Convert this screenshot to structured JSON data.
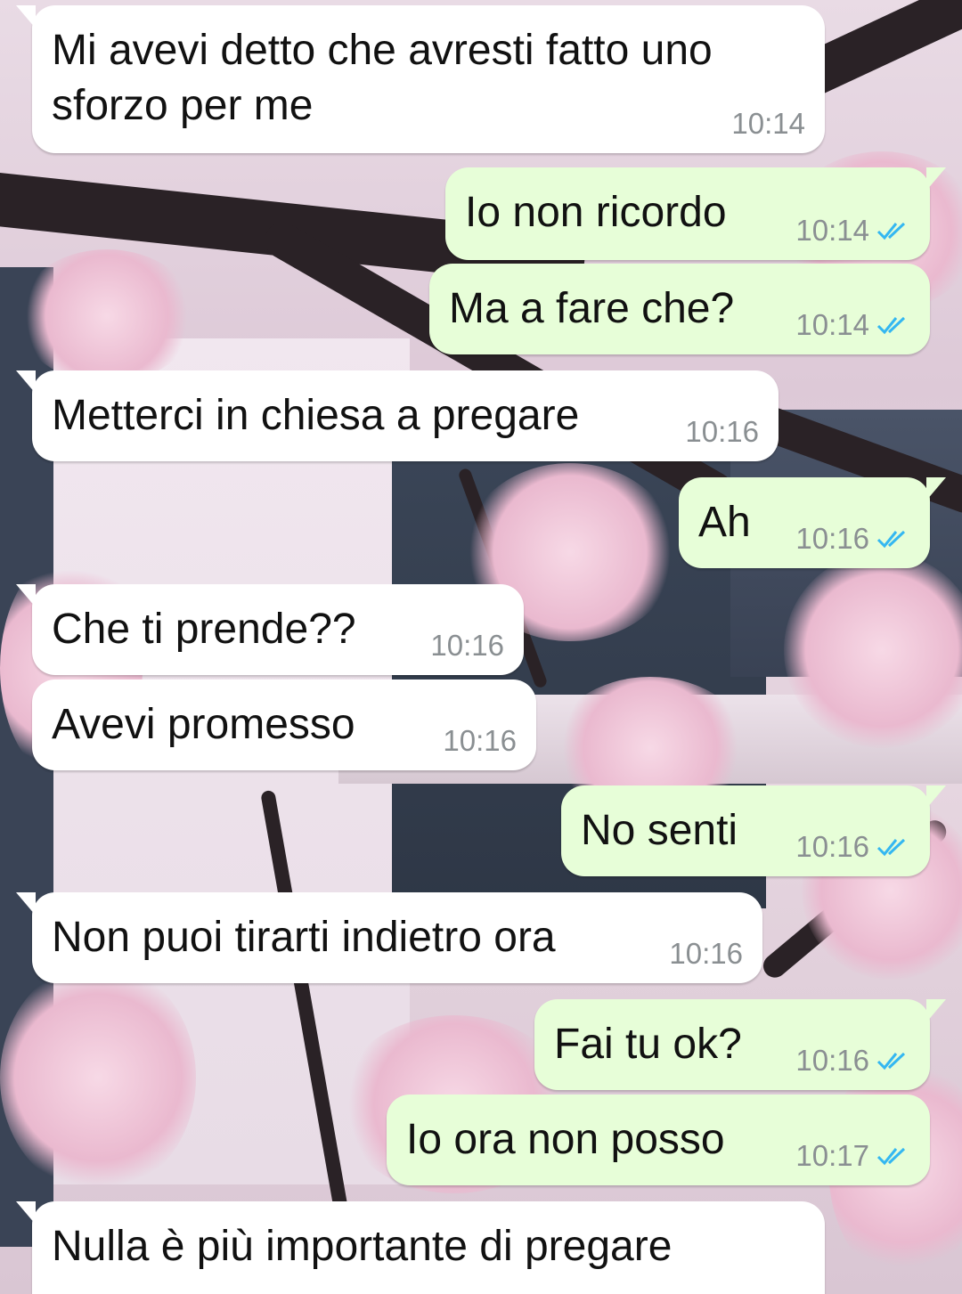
{
  "messages": [
    {
      "direction": "in",
      "text_lines": [
        "Mi avevi detto che avresti fatto uno",
        "sforzo per me"
      ],
      "time": "10:14"
    },
    {
      "direction": "out",
      "text": "Io non ricordo",
      "time": "10:14",
      "status": "read"
    },
    {
      "direction": "out",
      "text": "Ma a fare che?",
      "time": "10:14",
      "status": "read"
    },
    {
      "direction": "in",
      "text": "Metterci in chiesa a pregare",
      "time": "10:16"
    },
    {
      "direction": "out",
      "text": "Ah",
      "time": "10:16",
      "status": "read"
    },
    {
      "direction": "in",
      "text": "Che ti prende??",
      "time": "10:16"
    },
    {
      "direction": "in",
      "text": "Avevi promesso",
      "time": "10:16"
    },
    {
      "direction": "out",
      "text": "No senti",
      "time": "10:16",
      "status": "read"
    },
    {
      "direction": "in",
      "text": "Non puoi tirarti indietro ora",
      "time": "10:16"
    },
    {
      "direction": "out",
      "text": "Fai tu ok?",
      "time": "10:16",
      "status": "read"
    },
    {
      "direction": "out",
      "text": "Io ora non posso",
      "time": "10:17",
      "status": "read"
    },
    {
      "direction": "in",
      "text": "Nulla è più importante di pregare",
      "time": ""
    }
  ],
  "icons": {
    "read_receipt": "double-check-icon"
  },
  "colors": {
    "incoming_bubble": "#ffffff",
    "outgoing_bubble": "#e7fed8",
    "timestamp": "#8a8f92",
    "read_tick": "#34b7f1"
  }
}
